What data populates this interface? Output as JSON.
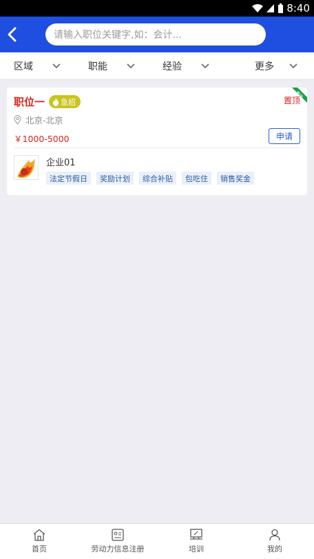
{
  "status": {
    "time": "8:40"
  },
  "search": {
    "placeholder": "请输入职位关键字,如：会计..."
  },
  "filters": [
    "区域",
    "职能",
    "经验",
    "更多"
  ],
  "job": {
    "title": "职位一",
    "urgent_label": "急招",
    "top_label": "置顶",
    "ribbon_label": "置顶",
    "location": "北京-北京",
    "salary": "￥1000-5000",
    "apply_label": "申请",
    "company": "企业01",
    "tags": [
      "法定节假日",
      "奖励计划",
      "综合补贴",
      "包吃住",
      "销售奖金"
    ]
  },
  "tabbar": [
    {
      "label": "首页",
      "icon": "home-icon"
    },
    {
      "label": "劳动力信息注册",
      "icon": "register-icon"
    },
    {
      "label": "培训",
      "icon": "training-icon"
    },
    {
      "label": "我的",
      "icon": "profile-icon"
    }
  ],
  "colors": {
    "primary": "#1f4fe0",
    "red": "#d9251d",
    "urgent": "#c9c420",
    "ribbon": "#1a9e4a"
  }
}
